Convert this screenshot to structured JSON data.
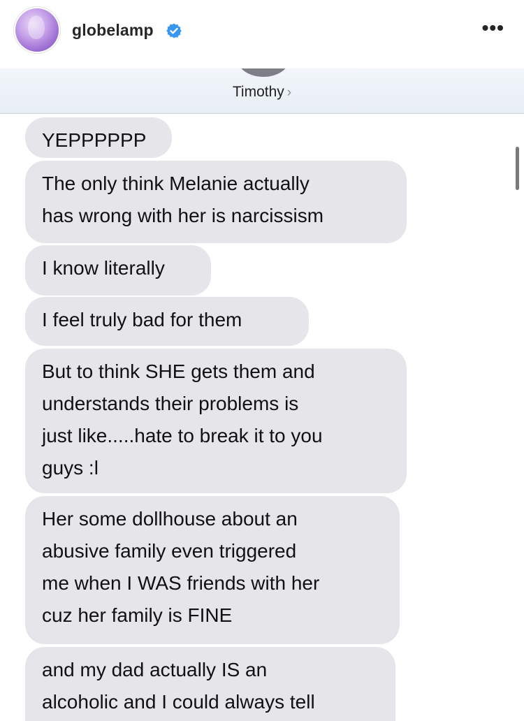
{
  "post": {
    "username": "globelamp",
    "verified_icon": "verified-badge-icon",
    "more_icon": "more-options-icon",
    "more_label": "•••"
  },
  "conversation": {
    "contact_name": "Timothy",
    "chevron": "›",
    "messages": [
      "YEPPPPPP",
      "The only think Melanie actually has wrong with her is narcissism",
      "I know literally",
      "I feel truly bad for them",
      "But to think SHE gets them and understands their problems is just like.....hate to break it to you guys :l",
      "Her some dollhouse about an abusive family even triggered me when I WAS friends with her cuz her family is FINE",
      "and my dad actually IS an alcoholic and I could always tell"
    ],
    "message_lines": [
      [
        "YEPPPPPP"
      ],
      [
        "The only think Melanie actually",
        "has wrong with her is narcissism"
      ],
      [
        "I know literally"
      ],
      [
        "I feel truly bad for them"
      ],
      [
        "But to think SHE gets them and",
        "understands their problems is",
        "just like.....hate to break it to you",
        "guys :l"
      ],
      [
        "Her some dollhouse about an",
        "abusive family even triggered",
        "me when I WAS friends with her",
        "cuz her family is FINE"
      ],
      [
        "and my dad actually IS an",
        "alcoholic and I could always tell"
      ]
    ],
    "bubble_color": "#e5e5ea"
  }
}
